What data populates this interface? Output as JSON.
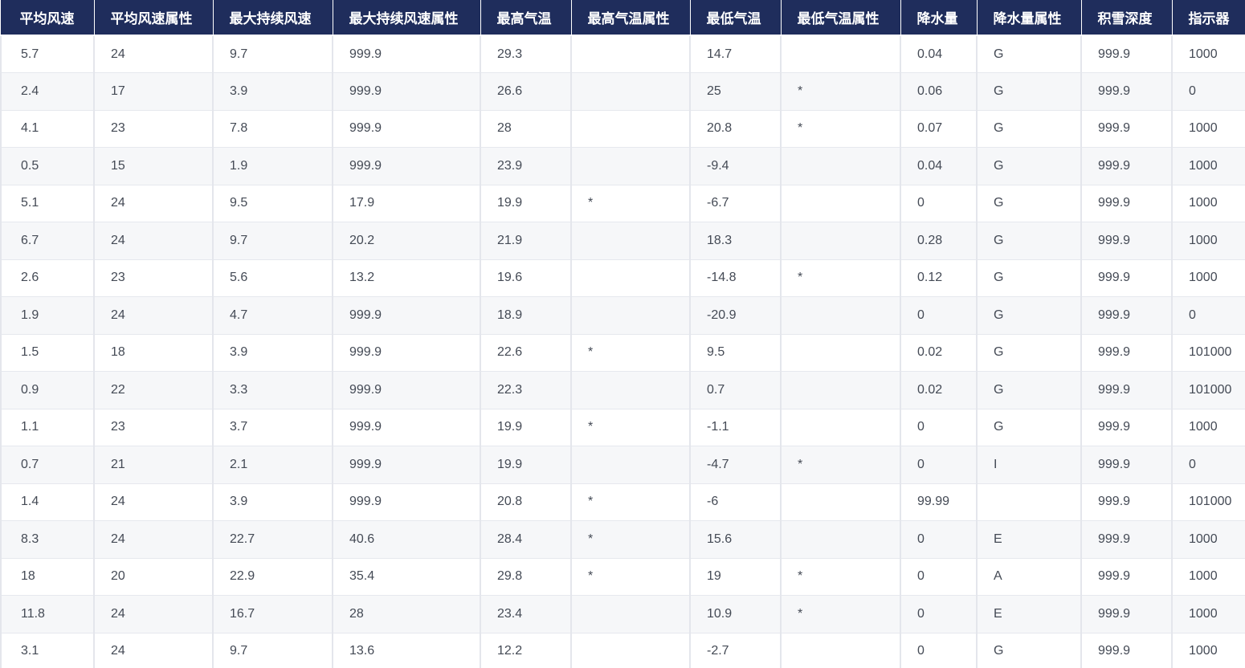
{
  "table": {
    "columns": [
      "平均风速",
      "平均风速属性",
      "最大持续风速",
      "最大持续风速属性",
      "最高气温",
      "最高气温属性",
      "最低气温",
      "最低气温属性",
      "降水量",
      "降水量属性",
      "积雪深度",
      "指示器"
    ],
    "rows": [
      [
        "5.7",
        "24",
        "9.7",
        "999.9",
        "29.3",
        "",
        "14.7",
        "",
        "0.04",
        "G",
        "999.9",
        "1000"
      ],
      [
        "2.4",
        "17",
        "3.9",
        "999.9",
        "26.6",
        "",
        "25",
        "*",
        "0.06",
        "G",
        "999.9",
        "0"
      ],
      [
        "4.1",
        "23",
        "7.8",
        "999.9",
        "28",
        "",
        "20.8",
        "*",
        "0.07",
        "G",
        "999.9",
        "1000"
      ],
      [
        "0.5",
        "15",
        "1.9",
        "999.9",
        "23.9",
        "",
        "-9.4",
        "",
        "0.04",
        "G",
        "999.9",
        "1000"
      ],
      [
        "5.1",
        "24",
        "9.5",
        "17.9",
        "19.9",
        "*",
        "-6.7",
        "",
        "0",
        "G",
        "999.9",
        "1000"
      ],
      [
        "6.7",
        "24",
        "9.7",
        "20.2",
        "21.9",
        "",
        "18.3",
        "",
        "0.28",
        "G",
        "999.9",
        "1000"
      ],
      [
        "2.6",
        "23",
        "5.6",
        "13.2",
        "19.6",
        "",
        "-14.8",
        "*",
        "0.12",
        "G",
        "999.9",
        "1000"
      ],
      [
        "1.9",
        "24",
        "4.7",
        "999.9",
        "18.9",
        "",
        "-20.9",
        "",
        "0",
        "G",
        "999.9",
        "0"
      ],
      [
        "1.5",
        "18",
        "3.9",
        "999.9",
        "22.6",
        "*",
        "9.5",
        "",
        "0.02",
        "G",
        "999.9",
        "101000"
      ],
      [
        "0.9",
        "22",
        "3.3",
        "999.9",
        "22.3",
        "",
        "0.7",
        "",
        "0.02",
        "G",
        "999.9",
        "101000"
      ],
      [
        "1.1",
        "23",
        "3.7",
        "999.9",
        "19.9",
        "*",
        "-1.1",
        "",
        "0",
        "G",
        "999.9",
        "1000"
      ],
      [
        "0.7",
        "21",
        "2.1",
        "999.9",
        "19.9",
        "",
        "-4.7",
        "*",
        "0",
        "I",
        "999.9",
        "0"
      ],
      [
        "1.4",
        "24",
        "3.9",
        "999.9",
        "20.8",
        "*",
        "-6",
        "",
        "99.99",
        "",
        "999.9",
        "101000"
      ],
      [
        "8.3",
        "24",
        "22.7",
        "40.6",
        "28.4",
        "*",
        "15.6",
        "",
        "0",
        "E",
        "999.9",
        "1000"
      ],
      [
        "18",
        "20",
        "22.9",
        "35.4",
        "29.8",
        "*",
        "19",
        "*",
        "0",
        "A",
        "999.9",
        "1000"
      ],
      [
        "11.8",
        "24",
        "16.7",
        "28",
        "23.4",
        "",
        "10.9",
        "*",
        "0",
        "E",
        "999.9",
        "1000"
      ],
      [
        "3.1",
        "24",
        "9.7",
        "13.6",
        "12.2",
        "",
        "-2.7",
        "",
        "0",
        "G",
        "999.9",
        "1000"
      ]
    ]
  },
  "colors": {
    "header_bg": "#1f2d5c",
    "header_text": "#ffffff",
    "row_alt_bg": "#f6f7f9",
    "cell_text": "#444a55",
    "grid_line": "#e4e6ec"
  }
}
